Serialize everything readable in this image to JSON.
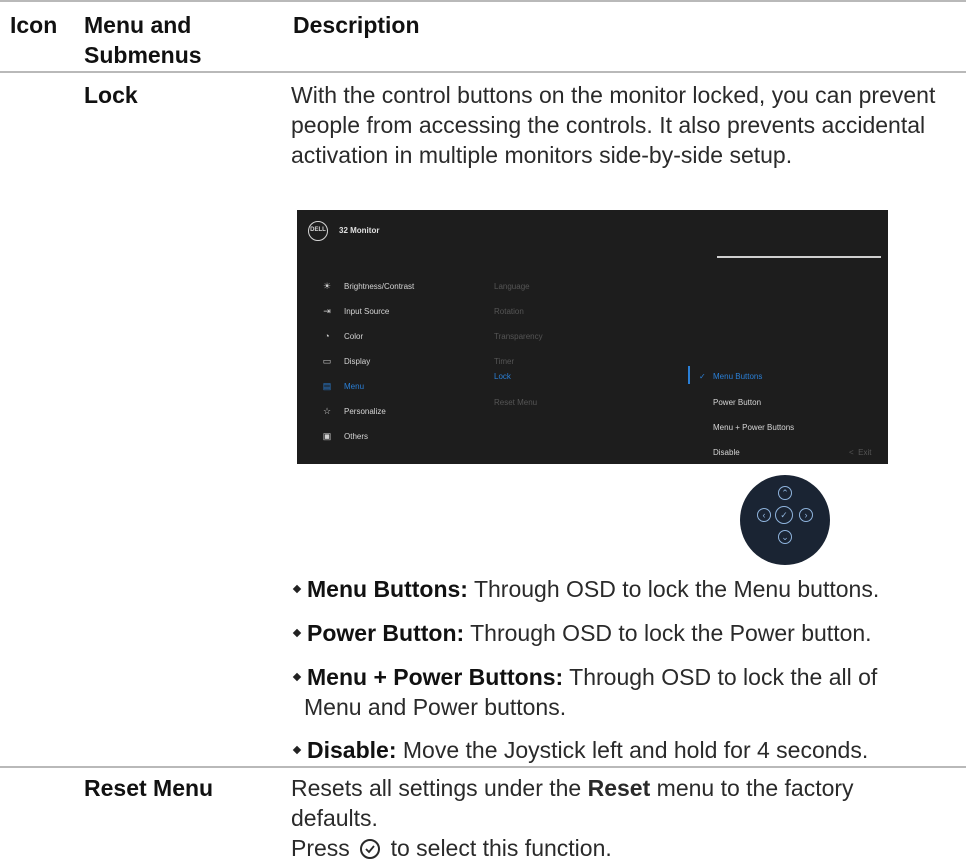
{
  "table": {
    "headers": {
      "icon": "Icon",
      "menu": "Menu and\nSubmenus",
      "description": "Description"
    }
  },
  "lock": {
    "name": "Lock",
    "description": "With the control buttons on the monitor locked, you can prevent people from accessing the controls. It also prevents accidental activation in multiple monitors side-by-side setup."
  },
  "osd": {
    "logo": "DELL",
    "model": "32 Monitor",
    "menu_items": [
      {
        "icon": "brightness-icon",
        "label": "Brightness/Contrast"
      },
      {
        "icon": "input-source-icon",
        "label": "Input Source"
      },
      {
        "icon": "color-icon",
        "label": "Color"
      },
      {
        "icon": "display-icon",
        "label": "Display"
      },
      {
        "icon": "menu-icon",
        "label": "Menu"
      },
      {
        "icon": "star-icon",
        "label": "Personalize"
      },
      {
        "icon": "others-icon",
        "label": "Others"
      }
    ],
    "submenu": [
      "Language",
      "Rotation",
      "Transparency",
      "Timer",
      "Lock",
      "Reset Menu"
    ],
    "options": [
      "Menu Buttons",
      "Power Button",
      "Menu + Power Buttons",
      "Disable"
    ],
    "exit_label": "Exit",
    "accent_color": "#2a7fd6"
  },
  "bullets": [
    {
      "term": "Menu Buttons:",
      "text": " Through OSD to lock the Menu buttons."
    },
    {
      "term": "Power Button:",
      "text": " Through OSD to lock the Power button."
    },
    {
      "term": "Menu + Power Buttons:",
      "text": " Through OSD to lock the all of",
      "text2": "Menu and Power buttons."
    },
    {
      "term": "Disable:",
      "text": " Move the Joystick left and hold for 4 seconds."
    }
  ],
  "reset": {
    "name": "Reset Menu",
    "desc_pre": "Resets all settings under the ",
    "desc_bold": "Reset",
    "desc_post": " menu to the factory",
    "desc_line2": "defaults.",
    "press_pre": "Press ",
    "press_post": " to select this function."
  }
}
